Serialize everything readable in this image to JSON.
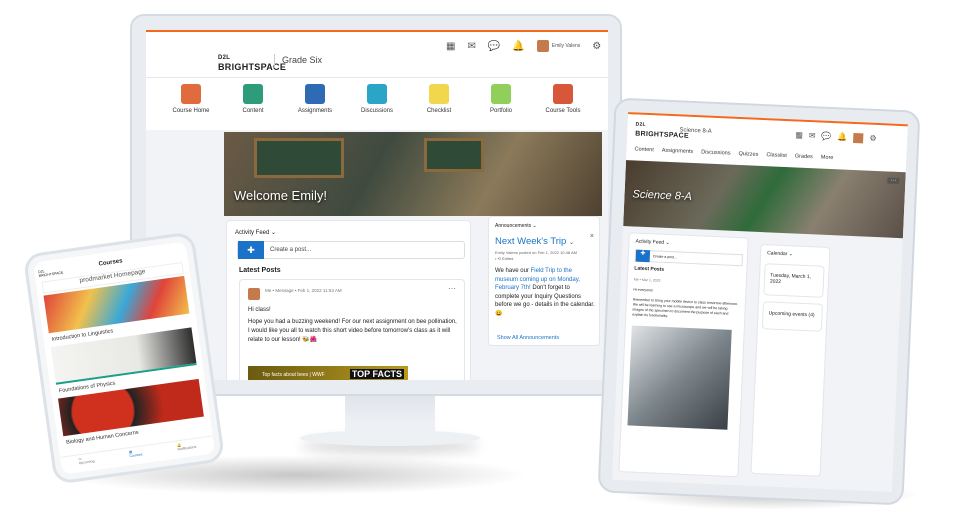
{
  "monitor": {
    "course_title": "Grade Six",
    "logo_top": "D2L",
    "logo_main": "BRIGHTSPACE",
    "user_name": "Emily Valens",
    "nav": [
      {
        "label": "Course Home",
        "color": "#e06b3c"
      },
      {
        "label": "Content",
        "color": "#2e9b7a"
      },
      {
        "label": "Assignments",
        "color": "#2f6bb5"
      },
      {
        "label": "Discussions",
        "color": "#2aa4c7"
      },
      {
        "label": "Checklist",
        "color": "#f2d64b"
      },
      {
        "label": "Portfolio",
        "color": "#8fcf5a"
      },
      {
        "label": "Course Tools",
        "color": "#d8563a"
      }
    ],
    "banner_text": "Welcome Emily!",
    "activity_feed": {
      "title": "Activity Feed",
      "create_placeholder": "Create a post...",
      "latest_posts": "Latest Posts",
      "post": {
        "meta": "Me • Message • Feb 1, 2022 11:53 AM",
        "greeting": "Hi class!",
        "body": "Hope you had a buzzing weekend! For our next assignment on bee pollination, I would like you all to watch this short video before tomorrow's class as it will relate to our lesson! 🐝🌺",
        "video_title": "Top facts about bees | WWF",
        "video_overlay": "TOP FACTS"
      }
    },
    "announcements": {
      "widget_title": "Announcements",
      "title": "Next Week's Trip",
      "meta": "Emily Valens posted on Feb 1, 2022 10:48 AM",
      "edited": "Edited",
      "text_before": "We have our ",
      "link_text": "Field Trip to the museum coming up on Monday, February 7th!",
      "text_after": " Don't forget to complete your Inquiry Questions before we go - details in the calendar. 😀",
      "show_all": "Show All Announcements"
    }
  },
  "tablet": {
    "logo_top": "D2L",
    "logo_main": "BRIGHTSPACE",
    "course_title": "Science 8-A",
    "tabs": [
      "Content",
      "Assignments",
      "Discussions",
      "Quizzes",
      "Classlist",
      "Grades",
      "More"
    ],
    "banner_text": "Science 8-A",
    "activity_feed": "Activity Feed",
    "create_placeholder": "Create a post...",
    "latest_posts": "Latest Posts",
    "post_meta": "Me • Mar 1, 2022",
    "post_greeting": "Hi everyone!",
    "post_body": "Remember to bring your mobile device to class tomorrow afternoon. We will be learning to use a microscope and we will be taking images of the specimen to document the purpose of each and explain its functionality.",
    "calendar": "Calendar",
    "date": "Tuesday, March 1, 2022",
    "upcoming": "Upcoming events (4)"
  },
  "phone": {
    "header": "Courses",
    "brand": "D2L BRIGHTSPACE",
    "courses": [
      {
        "title": "prodmarket Homepage"
      },
      {
        "title": "Introduction to Linguistics"
      },
      {
        "title": "Foundations of Physics"
      },
      {
        "title": "Biology and Human Concerns"
      }
    ],
    "tabs": [
      "Upcoming",
      "Courses",
      "Notifications"
    ]
  },
  "colors": {
    "accent": "#f56a1a",
    "link": "#1a73c8",
    "primary_button": "#1a73c8"
  }
}
